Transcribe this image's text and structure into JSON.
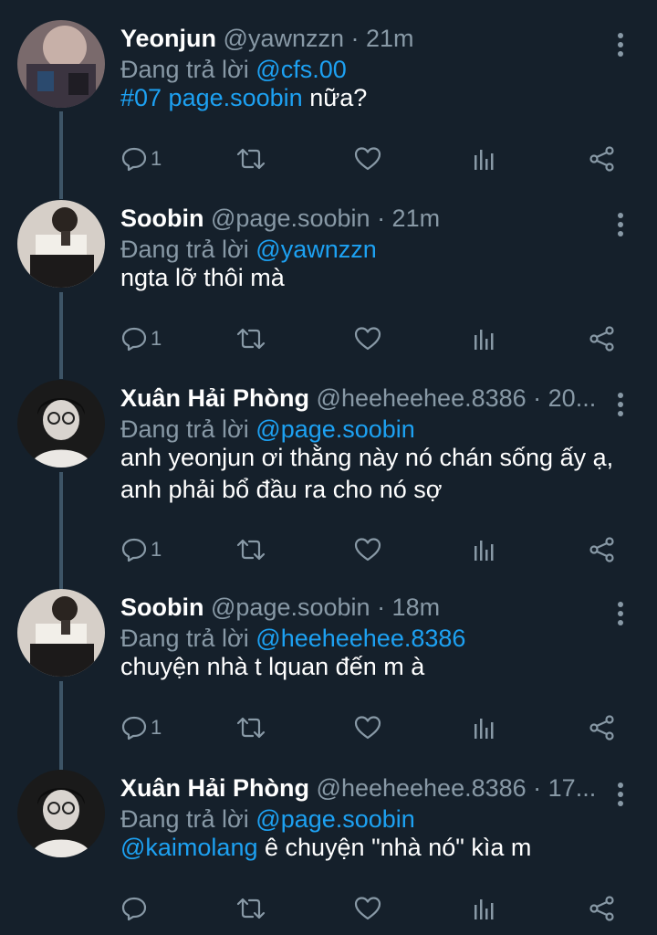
{
  "reply_prefix": "Đang trả lời",
  "tweets": [
    {
      "name": "Yeonjun",
      "handle": "@yawnzzn",
      "time": "· 21m",
      "reply_to": "@cfs.00",
      "text_link": "#07 page.soobin",
      "text": " nữa?",
      "reply_count": "1"
    },
    {
      "name": "Soobin",
      "handle": "@page.soobin",
      "time": "· 21m",
      "reply_to": "@yawnzzn",
      "text_link": "",
      "text": "ngta lỡ thôi mà",
      "reply_count": "1"
    },
    {
      "name": "Xuân Hải Phòng",
      "handle": "@heeheehee.8386",
      "time": "· 20...",
      "reply_to": "@page.soobin",
      "text_link": "",
      "text": "anh yeonjun ơi thằng này nó chán sống ấy ạ, anh phải bổ đầu ra cho nó sợ",
      "reply_count": "1"
    },
    {
      "name": "Soobin",
      "handle": "@page.soobin",
      "time": "· 18m",
      "reply_to": "@heeheehee.8386",
      "text_link": "",
      "text": "chuyện nhà t lquan đến m à",
      "reply_count": "1"
    },
    {
      "name": "Xuân Hải Phòng",
      "handle": "@heeheehee.8386",
      "time": "· 17...",
      "reply_to": "@page.soobin",
      "text_link": "@kaimolang",
      "text": " ê chuyện \"nhà nó\" kìa m",
      "reply_count": ""
    }
  ],
  "icons": {
    "reply": "reply-icon",
    "retweet": "retweet-icon",
    "like": "heart-icon",
    "analytics": "analytics-icon",
    "share": "share-icon",
    "more": "more-vertical-icon"
  },
  "colors": {
    "background": "#15202b",
    "link": "#1da1f2",
    "secondary": "#8899a6",
    "thread_line": "#3d5466"
  }
}
